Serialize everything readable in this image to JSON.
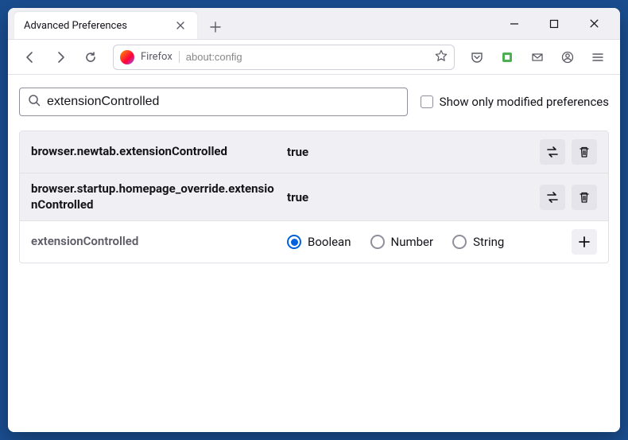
{
  "window": {
    "tab_title": "Advanced Preferences"
  },
  "toolbar": {
    "identity_label": "Firefox",
    "url": "about:config"
  },
  "config": {
    "search_value": "extensionControlled",
    "show_modified_label": "Show only modified preferences"
  },
  "prefs": [
    {
      "name": "browser.newtab.extensionControlled",
      "value": "true"
    },
    {
      "name": "browser.startup.homepage_override.extensionControlled",
      "value": "true"
    }
  ],
  "new_pref": {
    "name": "extensionControlled",
    "types": {
      "boolean": "Boolean",
      "number": "Number",
      "string": "String"
    }
  }
}
